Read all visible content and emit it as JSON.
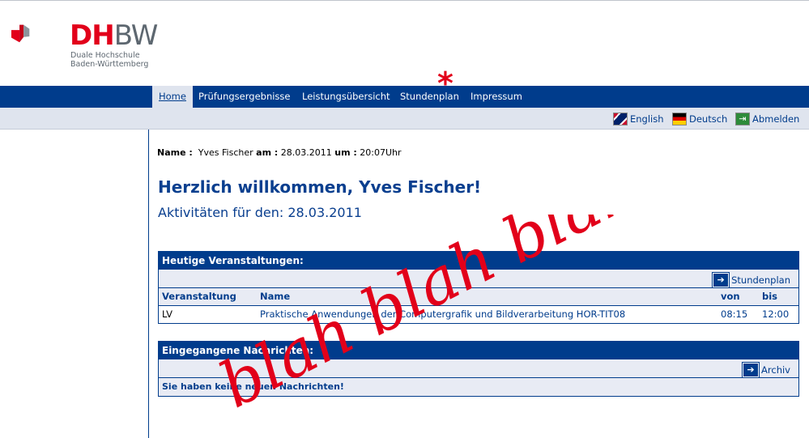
{
  "logo": {
    "primary": "DH",
    "secondary": "BW",
    "sub_line1": "Duale Hochschule",
    "sub_line2": "Baden-Württemberg"
  },
  "nav": {
    "items": [
      "Home",
      "Prüfungsergebnisse",
      "Leistungsübersicht",
      "Stundenplan",
      "Impressum"
    ],
    "annotation": "*"
  },
  "lang": {
    "english": "English",
    "deutsch": "Deutsch",
    "logout": "Abmelden"
  },
  "user": {
    "name_label": "Name :",
    "name": "Yves Fischer",
    "date_label": "am :",
    "date": "28.03.2011",
    "time_label": "um :",
    "time": "20:07Uhr"
  },
  "welcome": {
    "title": "Herzlich willkommen, Yves Fischer!",
    "activity": "Aktivitäten für den: 28.03.2011"
  },
  "events": {
    "title": "Heutige Veranstaltungen:",
    "link": "Stundenplan",
    "headers": [
      "Veranstaltung",
      "Name",
      "von",
      "bis"
    ],
    "rows": [
      {
        "type": "LV",
        "name": "Praktische Anwendungen der Computergrafik und Bildverarbeitung HOR-TIT08",
        "from": "08:15",
        "to": "12:00"
      }
    ]
  },
  "messages": {
    "title": "Eingegangene Nachrichten:",
    "link": "Archiv",
    "empty": "Sie haben keine neuen Nachrichten!"
  },
  "overlay": {
    "text": "blah blah blah",
    "color": "#e2001a"
  },
  "colors": {
    "brand_blue": "#003c8c",
    "brand_red": "#e2001a",
    "light_band": "#dfe4ee"
  }
}
